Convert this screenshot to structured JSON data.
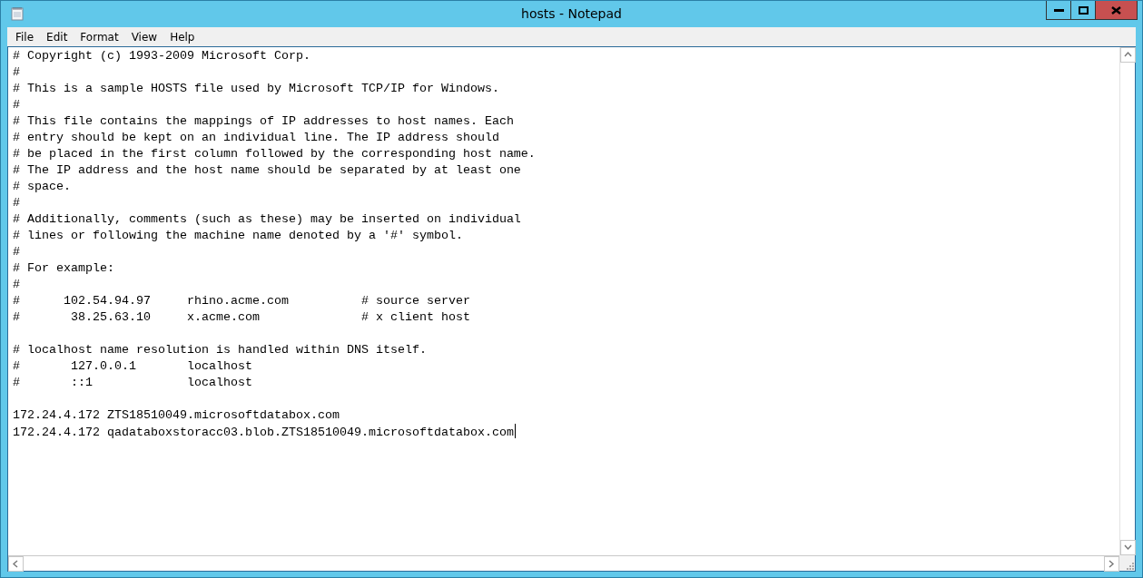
{
  "window": {
    "title": "hosts - Notepad"
  },
  "menu": [
    "File",
    "Edit",
    "Format",
    "View",
    "Help"
  ],
  "document": {
    "blocks": [
      [
        "# Copyright (c) 1993-2009 Microsoft Corp.",
        "#",
        "# This is a sample HOSTS file used by Microsoft TCP/IP for Windows.",
        "#",
        "# This file contains the mappings of IP addresses to host names. Each",
        "# entry should be kept on an individual line. The IP address should",
        "# be placed in the first column followed by the corresponding host name.",
        "# The IP address and the host name should be separated by at least one",
        "# space.",
        "#",
        "# Additionally, comments (such as these) may be inserted on individual",
        "# lines or following the machine name denoted by a '#' symbol.",
        "#",
        "# For example:",
        "#",
        "#      102.54.94.97     rhino.acme.com          # source server",
        "#       38.25.63.10     x.acme.com              # x client host"
      ],
      [
        "# localhost name resolution is handled within DNS itself.",
        "#       127.0.0.1       localhost",
        "#       ::1             localhost"
      ],
      [
        "172.24.4.172 ZTS18510049.microsoftdatabox.com",
        "172.24.4.172 qadataboxstoracc03.blob.ZTS18510049.microsoftdatabox.com"
      ]
    ]
  }
}
